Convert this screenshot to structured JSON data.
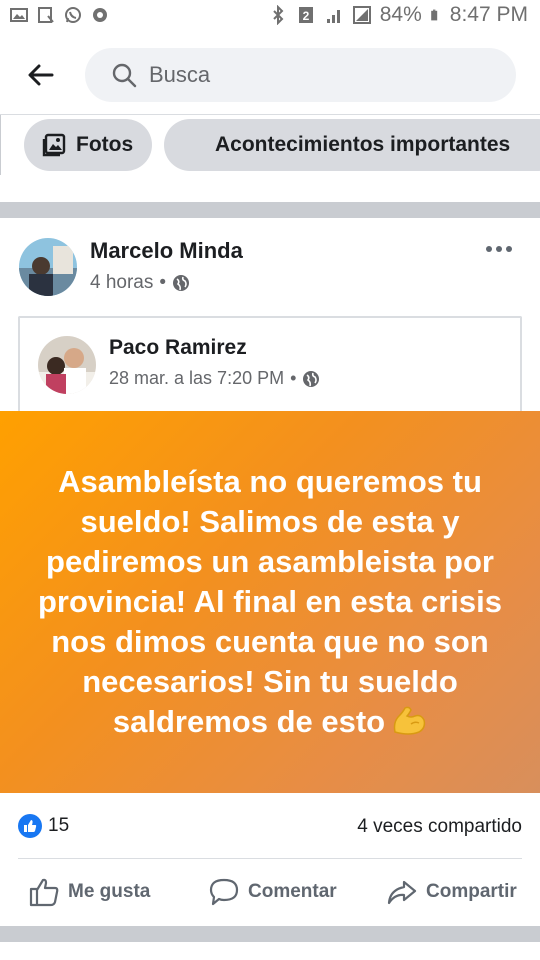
{
  "status_bar": {
    "battery": "84%",
    "time": "8:47 PM",
    "left_icons": [
      "image-icon",
      "download-icon",
      "whatsapp-icon",
      "settings-icon"
    ],
    "right_icons": [
      "bluetooth-icon",
      "sim-icon",
      "signal-icon",
      "battery-icon"
    ]
  },
  "search": {
    "placeholder": "Busca"
  },
  "chips": {
    "fotos": "Fotos",
    "acontecimientos": "Acontecimientos importantes"
  },
  "post": {
    "author": "Marcelo Minda",
    "time": "4 horas",
    "separator": "•",
    "shared": {
      "author": "Paco Ramirez",
      "time": "28 mar. a las 7:20 PM",
      "separator": "•"
    },
    "text": "Asambleísta no queremos tu sueldo! Salimos de esta y pediremos un asambleista por provincia! Al final en esta crisis nos dimos cuenta que no son necesarios! Sin tu sueldo saldremos de esto",
    "reactions_count": "15",
    "shares": "4 veces compartido",
    "actions": {
      "like": "Me gusta",
      "comment": "Comentar",
      "share": "Compartir"
    }
  },
  "colors": {
    "accent": "#1877f2",
    "banner_start": "#ffa000",
    "banner_end": "#d88f5c",
    "chip_bg": "#d8dadf",
    "separator": "#c9ccd1"
  }
}
